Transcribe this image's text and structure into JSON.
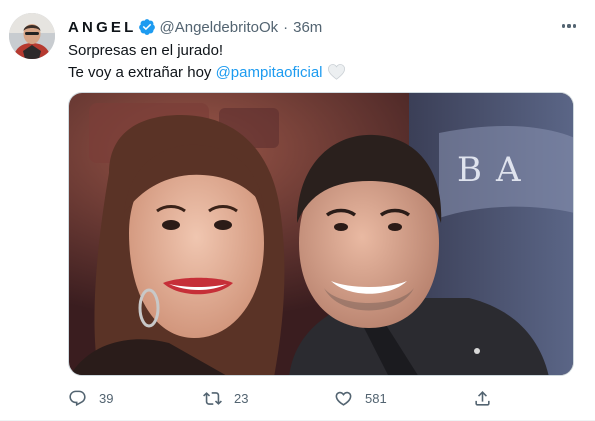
{
  "tweet": {
    "author": {
      "display_name": "ANGEL",
      "handle": "@AngeldebritoOk",
      "verified": true
    },
    "separator": "·",
    "time": "36m",
    "text_line1": "Sorpresas en el jurado!",
    "text_line2_prefix": "Te voy a extrañar hoy ",
    "mention": "@pampitaoficial",
    "emoji": "white-heart",
    "media_backdrop_text": "BA",
    "stats": {
      "replies": "39",
      "retweets": "23",
      "likes": "581"
    }
  },
  "colors": {
    "accent": "#1d9bf0",
    "text": "#0f1419",
    "secondary": "#536471"
  }
}
